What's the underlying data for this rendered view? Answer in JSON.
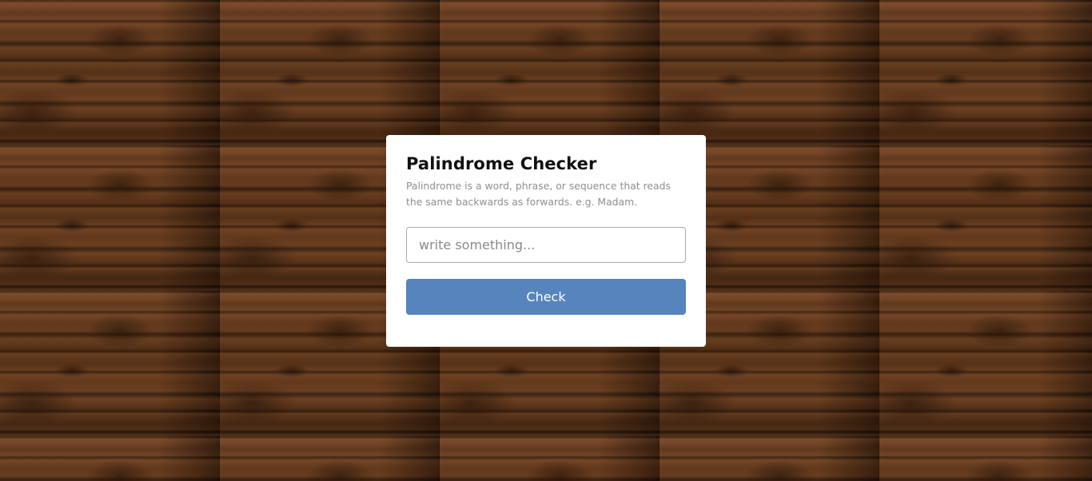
{
  "card": {
    "title": "Palindrome Checker",
    "description": "Palindrome is a word, phrase, or sequence that reads the same backwards as forwards. e.g. Madam.",
    "input": {
      "value": "",
      "placeholder": "write something..."
    },
    "check_label": "Check"
  },
  "colors": {
    "accent": "#5684bc",
    "card_bg": "#ffffff",
    "title": "#111111",
    "description": "#8f8f8f"
  }
}
